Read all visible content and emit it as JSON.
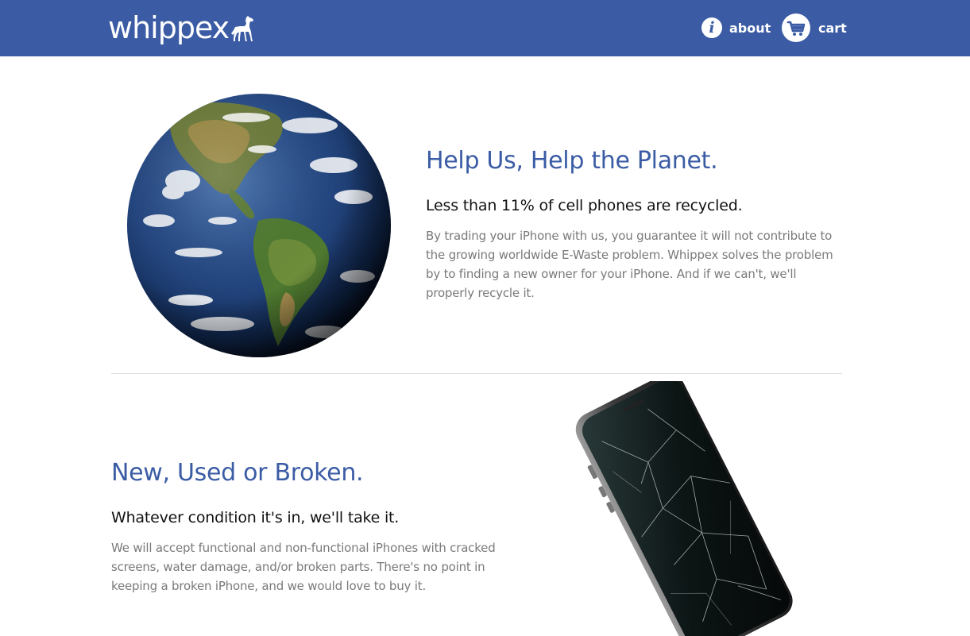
{
  "header": {
    "logo_text": "whippex",
    "nav": {
      "about_label": "about",
      "cart_label": "cart"
    },
    "background_color": "#3b5ca5"
  },
  "sections": [
    {
      "title": "Help Us, Help the Planet.",
      "subtitle": "Less than 11% of cell phones are recycled.",
      "body": "By trading your iPhone with us, you guarantee it will not contribute to the growing worldwide E-Waste problem. Whippex solves the problem by to finding a new owner for your iPhone. And if we can't, we'll properly recycle it.",
      "image": "earth-globe"
    },
    {
      "title": "New, Used or Broken.",
      "subtitle": "Whatever condition it's in, we'll take it.",
      "body": "We will accept functional and non-functional iPhones with cracked screens, water damage, and/or broken parts. There's no point in keeping a broken iPhone, and we would love to buy it.",
      "image": "broken-iphone"
    }
  ],
  "colors": {
    "accent": "#3b5ca5",
    "heading": "#3b5ca5",
    "subheading": "#111111",
    "body_text": "#7a7a7a",
    "divider": "#dddddd"
  },
  "icons": {
    "about": "info-icon",
    "cart": "cart-icon",
    "logo_mark": "whippet-dog-icon"
  }
}
